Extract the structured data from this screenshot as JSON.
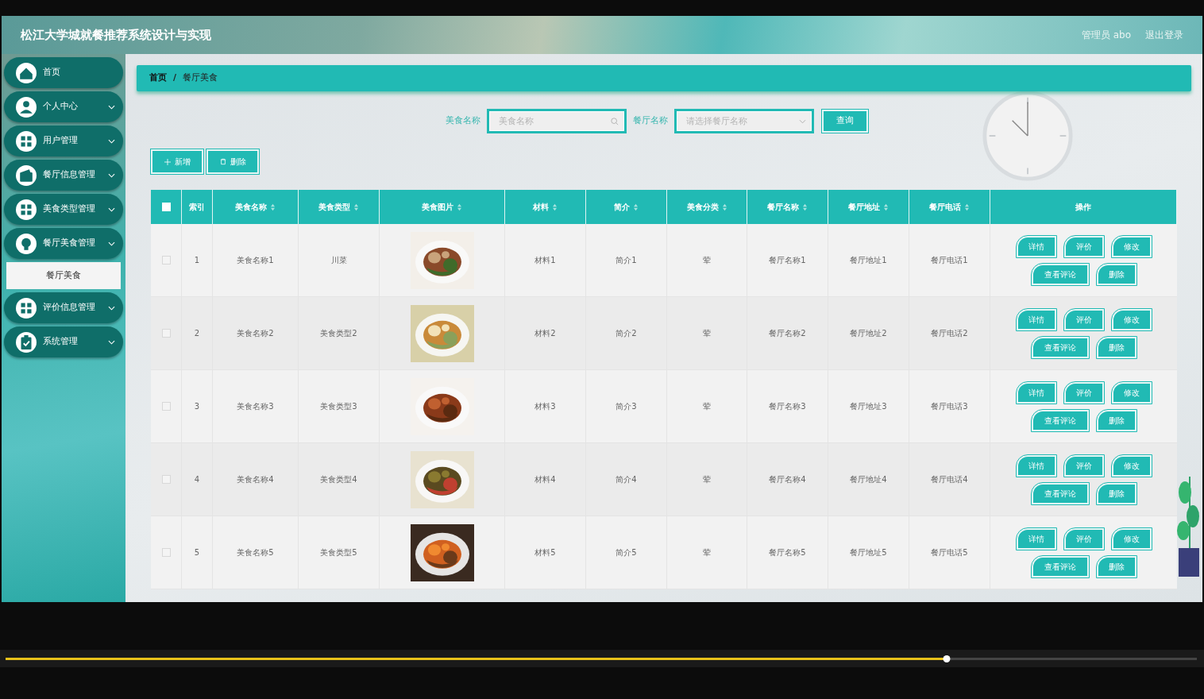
{
  "header": {
    "title": "松江大学城就餐推荐系统设计与实现",
    "user": "管理员 abo",
    "logout": "退出登录"
  },
  "sidebar": {
    "items": [
      {
        "label": "首页",
        "expandable": false
      },
      {
        "label": "个人中心",
        "expandable": true
      },
      {
        "label": "用户管理",
        "expandable": true
      },
      {
        "label": "餐厅信息管理",
        "expandable": true
      },
      {
        "label": "美食类型管理",
        "expandable": true
      },
      {
        "label": "餐厅美食管理",
        "expandable": true,
        "children": [
          {
            "label": "餐厅美食",
            "selected": true
          }
        ]
      },
      {
        "label": "评价信息管理",
        "expandable": true
      },
      {
        "label": "系统管理",
        "expandable": true
      }
    ]
  },
  "breadcrumb": {
    "items": [
      "首页",
      "餐厅美食"
    ],
    "separator": "/"
  },
  "search": {
    "fields": [
      {
        "label": "美食名称",
        "placeholder": "美食名称",
        "kind": "text"
      },
      {
        "label": "餐厅名称",
        "placeholder": "请选择餐厅名称",
        "kind": "select"
      }
    ],
    "button": "查询"
  },
  "toolbar": [
    {
      "label": "新增",
      "kind": "add"
    },
    {
      "label": "删除",
      "kind": "delete"
    }
  ],
  "table": {
    "header_checked": false,
    "columns": [
      {
        "label": "索引",
        "sortable": false
      },
      {
        "label": "美食名称",
        "sortable": true
      },
      {
        "label": "美食类型",
        "sortable": true
      },
      {
        "label": "美食图片",
        "sortable": true
      },
      {
        "label": "材料",
        "sortable": true
      },
      {
        "label": "简介",
        "sortable": true
      },
      {
        "label": "美食分类",
        "sortable": true
      },
      {
        "label": "餐厅名称",
        "sortable": true
      },
      {
        "label": "餐厅地址",
        "sortable": true
      },
      {
        "label": "餐厅电话",
        "sortable": true
      },
      {
        "label": "操作",
        "sortable": false
      }
    ],
    "rows": [
      {
        "checked": false,
        "cells": [
          "1",
          "美食名称1",
          "川菜",
          "",
          "材料1",
          "简介1",
          "荤",
          "餐厅名称1",
          "餐厅地址1",
          "餐厅电话1"
        ],
        "actions": [
          "详情",
          "评价",
          "修改",
          "查看评论",
          "删除"
        ]
      },
      {
        "checked": false,
        "cells": [
          "2",
          "美食名称2",
          "美食类型2",
          "",
          "材料2",
          "简介2",
          "荤",
          "餐厅名称2",
          "餐厅地址2",
          "餐厅电话2"
        ],
        "actions": [
          "详情",
          "评价",
          "修改",
          "查看评论",
          "删除"
        ]
      },
      {
        "checked": false,
        "cells": [
          "3",
          "美食名称3",
          "美食类型3",
          "",
          "材料3",
          "简介3",
          "荤",
          "餐厅名称3",
          "餐厅地址3",
          "餐厅电话3"
        ],
        "actions": [
          "详情",
          "评价",
          "修改",
          "查看评论",
          "删除"
        ]
      },
      {
        "checked": false,
        "cells": [
          "4",
          "美食名称4",
          "美食类型4",
          "",
          "材料4",
          "简介4",
          "荤",
          "餐厅名称4",
          "餐厅地址4",
          "餐厅电话4"
        ],
        "actions": [
          "详情",
          "评价",
          "修改",
          "查看评论",
          "删除"
        ]
      },
      {
        "checked": false,
        "cells": [
          "5",
          "美食名称5",
          "美食类型5",
          "",
          "材料5",
          "简介5",
          "荤",
          "餐厅名称5",
          "餐厅地址5",
          "餐厅电话5"
        ],
        "actions": [
          "详情",
          "评价",
          "修改",
          "查看评论",
          "删除"
        ]
      }
    ]
  },
  "player": {
    "progress": {
      "level": 0.79
    }
  }
}
